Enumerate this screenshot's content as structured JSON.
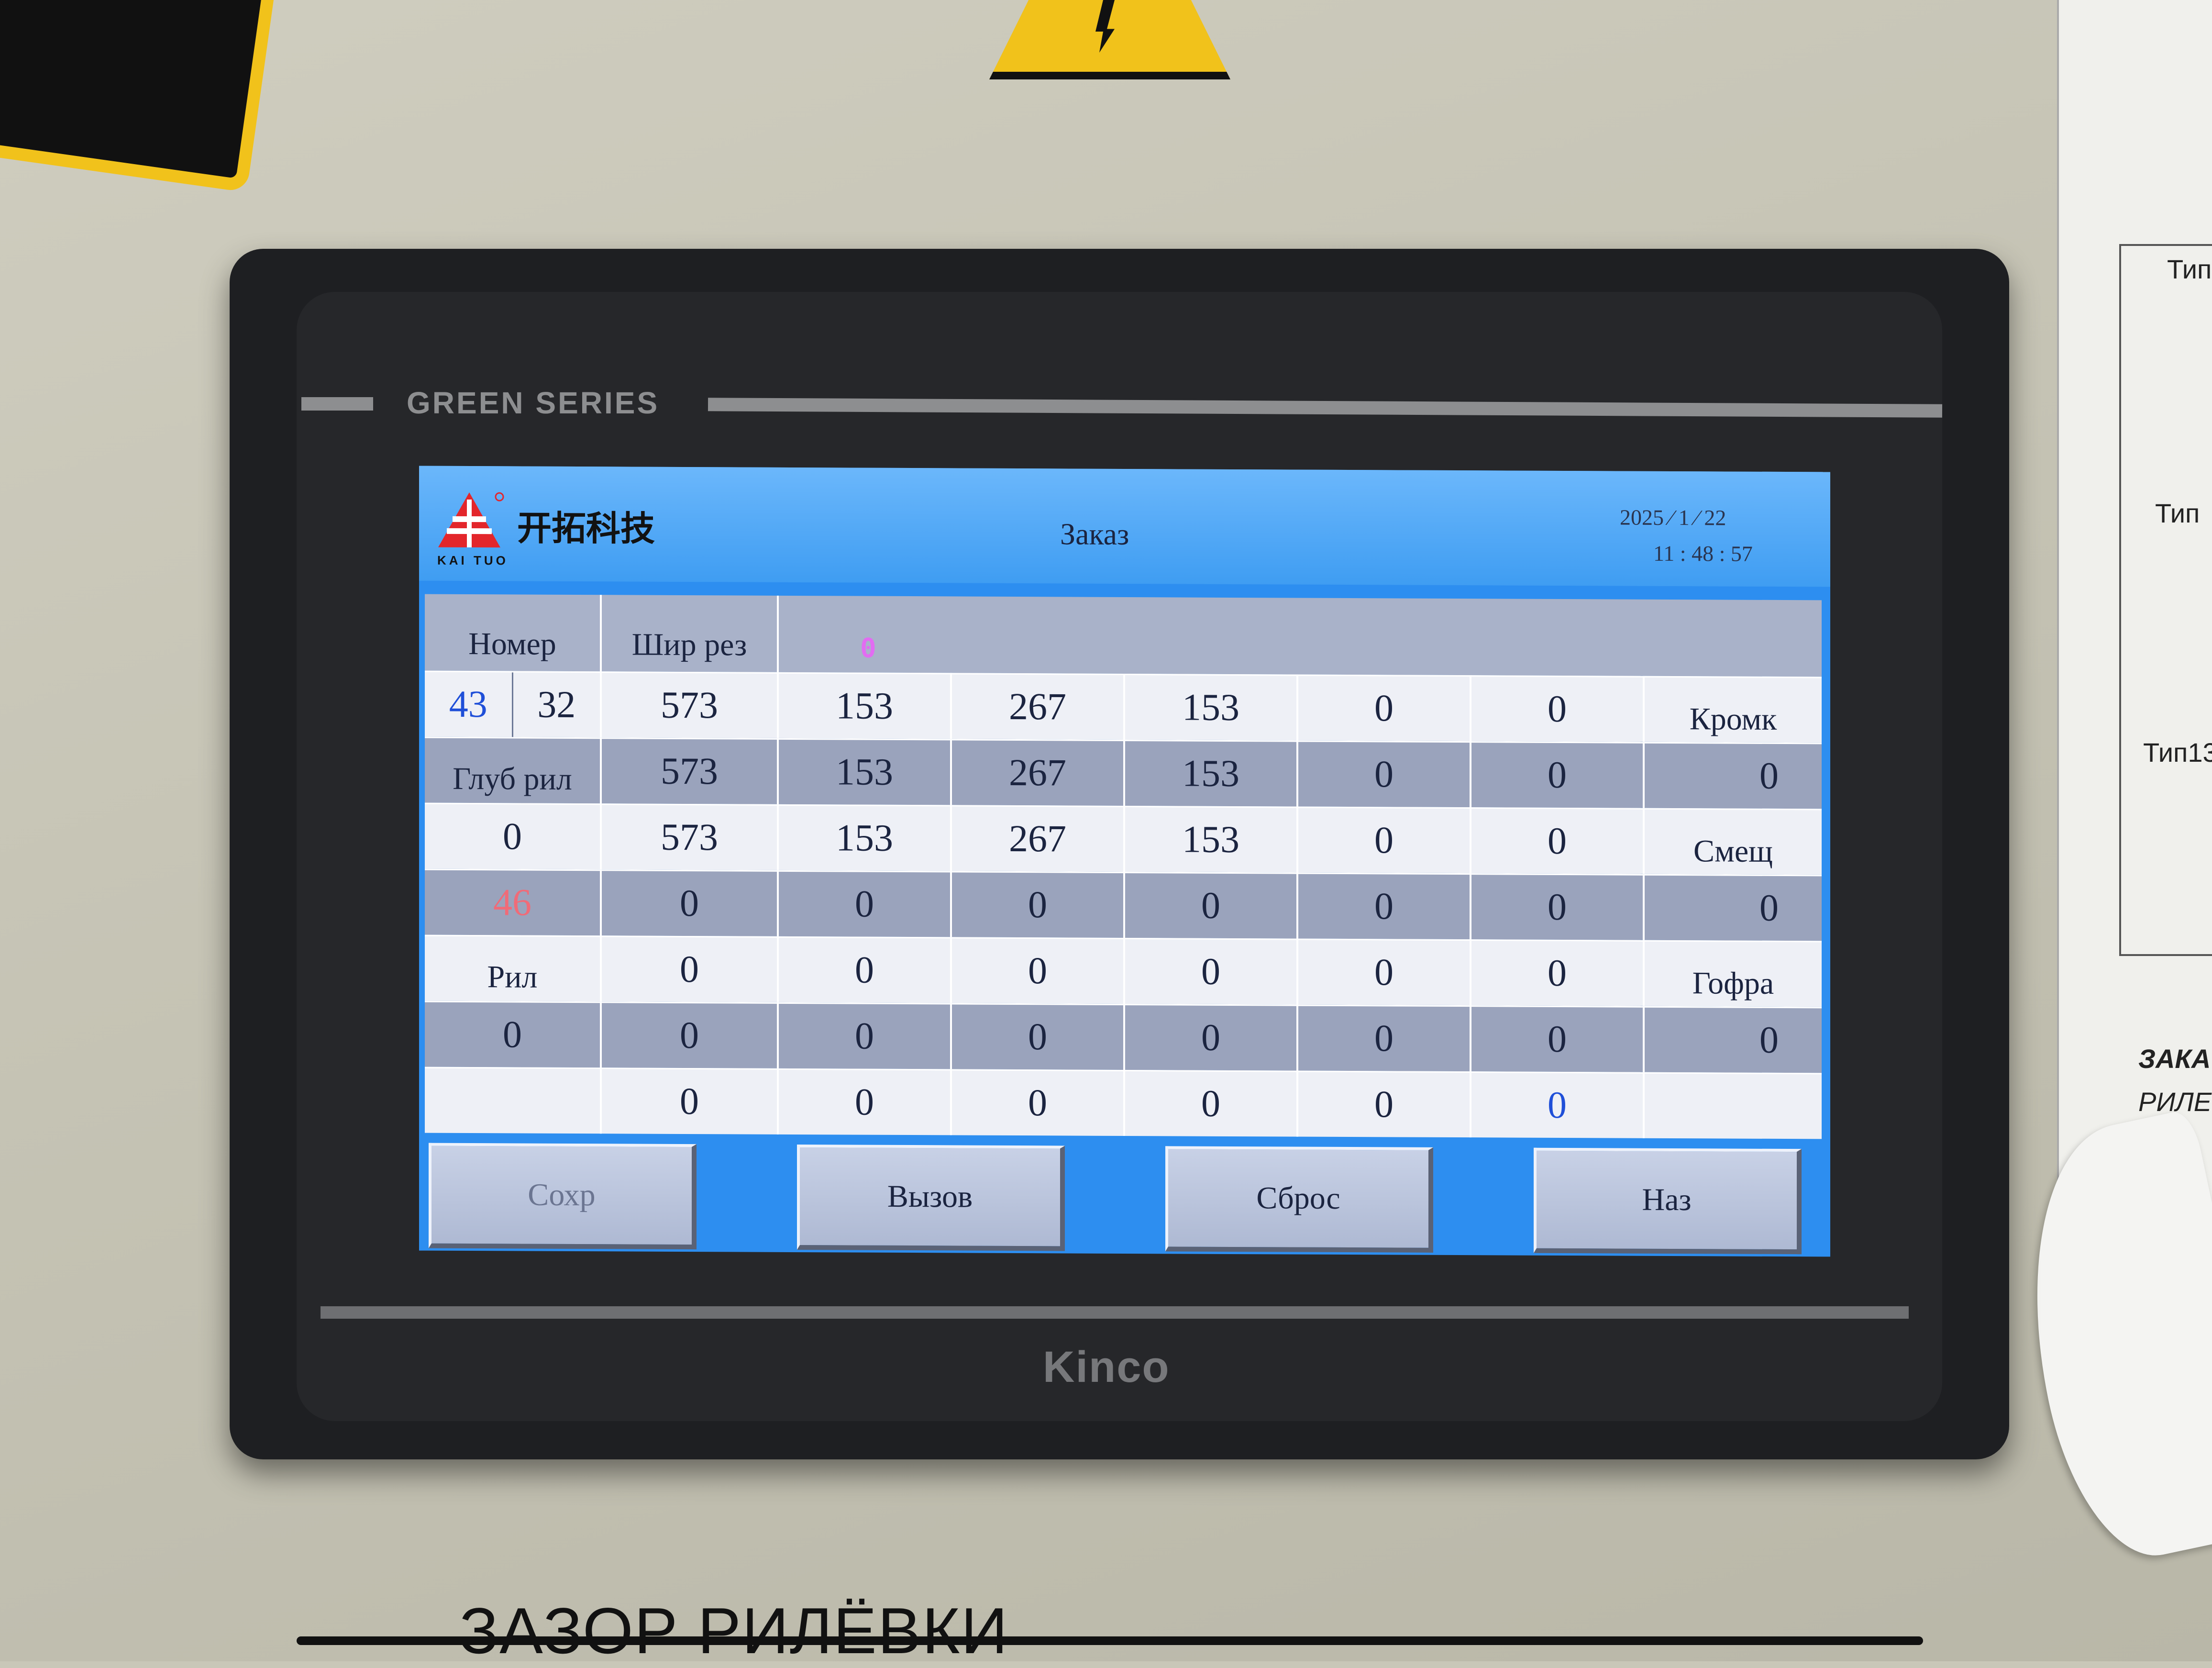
{
  "device": {
    "series": "GREEN  SERIES",
    "brand": "Kinco"
  },
  "header": {
    "logo_cn": "开拓科技",
    "logo_en": "KAI TUO",
    "title": "Заказ",
    "date": "2025 ⁄    1 ⁄  22",
    "time": "11 :   48  :  57"
  },
  "table": {
    "headers": [
      "Номер",
      "Шир рез",
      "0"
    ],
    "rows": [
      [
        "43",
        "32",
        "573",
        "153",
        "267",
        "153",
        "0",
        "0",
        "Кромк"
      ],
      [
        "Глуб рил",
        "573",
        "153",
        "267",
        "153",
        "0",
        "0",
        "0"
      ],
      [
        "0",
        "573",
        "153",
        "267",
        "153",
        "0",
        "0",
        "Смещ"
      ],
      [
        "46",
        "0",
        "0",
        "0",
        "0",
        "0",
        "0",
        "0"
      ],
      [
        "Рил",
        "0",
        "0",
        "0",
        "0",
        "0",
        "0",
        "Гофра"
      ],
      [
        "0",
        "0",
        "0",
        "0",
        "0",
        "0",
        "0",
        "0"
      ],
      [
        "",
        "0",
        "0",
        "0",
        "0",
        "0",
        "0",
        ""
      ]
    ]
  },
  "buttons": {
    "save": "Сохр",
    "recall": "Вызов",
    "reset": "Сброс",
    "back": "Наз"
  },
  "surroundings": {
    "bottom_label": "ЗАЗОР РИЛЁВКИ",
    "paper_1": "Тип",
    "paper_2": "Тип",
    "paper_3": "Тип13",
    "paper_4": "ЗАКА",
    "paper_5": "РИЛЕ"
  },
  "colors": {
    "screen_bg": "#2d8ef0",
    "title_bar": "#5aaef8",
    "row_light": "#eef0f6",
    "row_dark": "#9aa3bc",
    "header_zero": "#e26cf2",
    "number_blue": "#1f4fd8",
    "number_red": "#f06b78"
  }
}
